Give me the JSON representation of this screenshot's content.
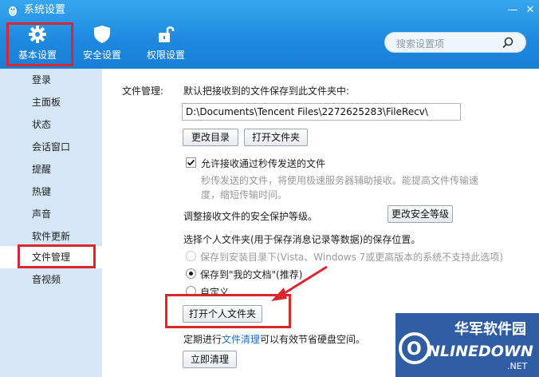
{
  "window": {
    "title": "系统设置",
    "minimize": "—",
    "close": "✕"
  },
  "tabs": [
    {
      "label": "基本设置",
      "icon": "gear-icon"
    },
    {
      "label": "安全设置",
      "icon": "shield-icon"
    },
    {
      "label": "权限设置",
      "icon": "lock-icon"
    }
  ],
  "search": {
    "placeholder": "搜索设置项"
  },
  "sidebar": {
    "items": [
      {
        "label": "登录"
      },
      {
        "label": "主面板"
      },
      {
        "label": "状态"
      },
      {
        "label": "会话窗口"
      },
      {
        "label": "提醒"
      },
      {
        "label": "热键"
      },
      {
        "label": "声音"
      },
      {
        "label": "软件更新"
      },
      {
        "label": "文件管理"
      },
      {
        "label": "音视频"
      }
    ]
  },
  "file_mgmt": {
    "section_label": "文件管理:",
    "default_path_label": "默认把接收到的文件保存到此文件夹中:",
    "path_value": "D:\\Documents\\Tencent Files\\2272625283\\FileRecv\\",
    "change_dir_button": "更改目录",
    "open_folder_button": "打开文件夹",
    "allow_instant_label": "允许接收通过秒传发送的文件",
    "instant_desc_line1": "秒传发送的文件，将使用极速服务器辅助接收。能提高文件传输速",
    "instant_desc_line2": "度，缩短传输时间。",
    "security_level_label": "调整接收文件的安全保护等级。",
    "change_security_button": "更改安全等级",
    "personal_folder_label": "选择个人文件夹(用于保存消息记录等数据)的保存位置。",
    "radio_install_dir": "保存到安装目录下(Vista、Windows 7或更高版本的系统不支持此选项)",
    "radio_my_docs": "保存到\"我的文档\"(推荐)",
    "radio_custom": "自定义",
    "open_personal_button": "打开个人文件夹",
    "cleanup_prefix": "定期进行",
    "cleanup_link": "文件清理",
    "cleanup_suffix": "可以有效节省硬盘空间。",
    "cleanup_now_button": "立即清理"
  },
  "watermark": {
    "top_text": "华军软件园",
    "brand": "ONLINEDOWN",
    "suffix": ".NET"
  },
  "colors": {
    "header": "#1e88df",
    "sidebar_bg": "#d5e7f7",
    "highlight": "#d8272f",
    "link": "#1a6fc6"
  }
}
